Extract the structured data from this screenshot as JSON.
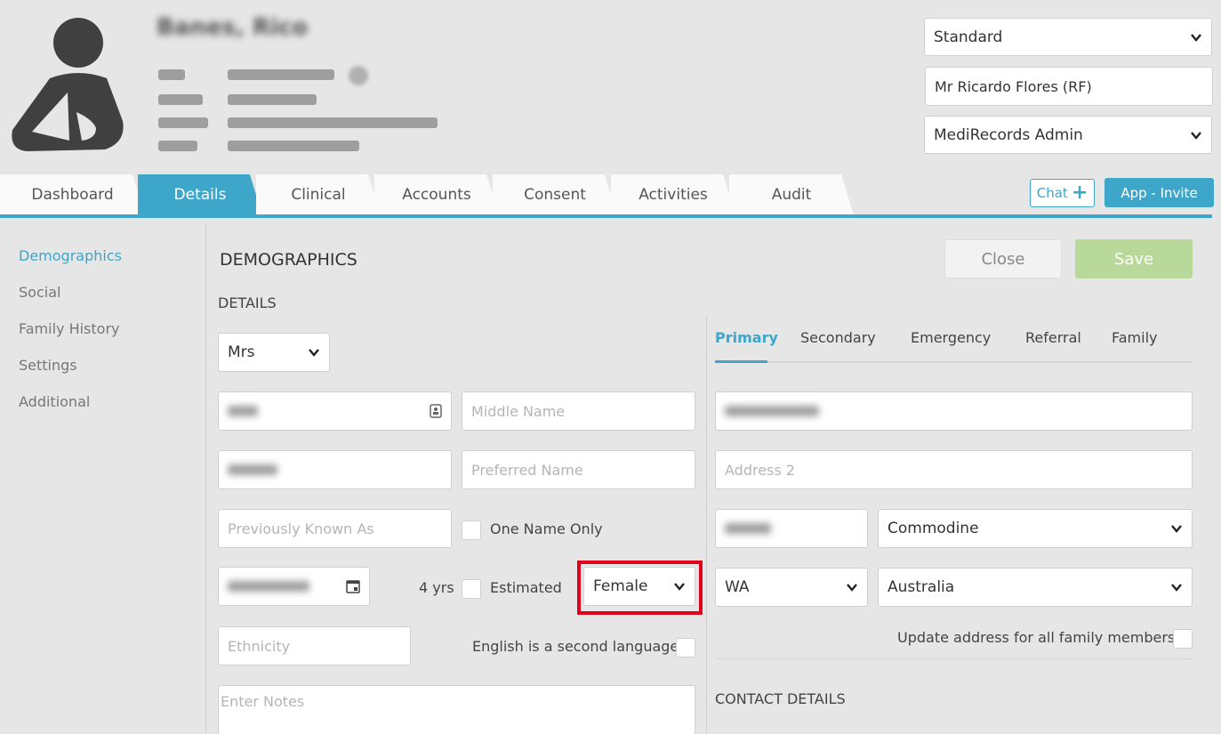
{
  "header": {
    "patient_name": "Banes, Rico",
    "standard_select": "Standard",
    "practitioner": "Mr Ricardo Flores (RF)",
    "admin_select": "MediRecords Admin"
  },
  "tabs": [
    "Dashboard",
    "Details",
    "Clinical",
    "Accounts",
    "Consent",
    "Activities",
    "Audit"
  ],
  "actions": {
    "chat": "Chat",
    "chat_plus": "+",
    "invite": "App - Invite"
  },
  "sidenav": [
    "Demographics",
    "Social",
    "Family History",
    "Settings",
    "Additional"
  ],
  "demographics": {
    "title": "DEMOGRAPHICS",
    "close": "Close",
    "save": "Save",
    "details_label": "DETAILS",
    "title_select": "Mrs",
    "middle_name_placeholder": "Middle Name",
    "preferred_name_placeholder": "Preferred Name",
    "previously_known_placeholder": "Previously Known As",
    "one_name_only": "One Name Only",
    "age": "4 yrs",
    "estimated": "Estimated",
    "gender": "Female",
    "ethnicity_placeholder": "Ethnicity",
    "english_second": "English is a second language",
    "notes_placeholder": "Enter Notes"
  },
  "address": {
    "subtabs": [
      "Primary",
      "Secondary",
      "Emergency",
      "Referral",
      "Family"
    ],
    "address2_placeholder": "Address 2",
    "suburb": "Commodine",
    "state": "WA",
    "country": "Australia",
    "update_family": "Update address for all family members",
    "contact_details": "CONTACT DETAILS"
  }
}
